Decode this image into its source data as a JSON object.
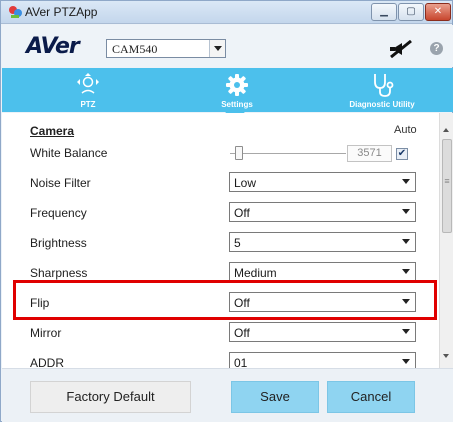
{
  "window": {
    "title": "AVer PTZApp"
  },
  "header": {
    "logo_text": "AVer",
    "camera_model": "CAM540",
    "help_label": "?"
  },
  "tabs": [
    {
      "label": "PTZ",
      "icon": "ptz-joystick-icon"
    },
    {
      "label": "Settings",
      "icon": "gear-icon",
      "active": true
    },
    {
      "label": "Diagnostic Utility",
      "icon": "stethoscope-icon"
    }
  ],
  "camera": {
    "section_title": "Camera",
    "auto_label": "Auto",
    "white_balance": {
      "label": "White Balance",
      "value": "3571",
      "auto_checked": true,
      "slider_fraction": 0.08
    },
    "noise_filter": {
      "label": "Noise Filter",
      "value": "Low"
    },
    "frequency": {
      "label": "Frequency",
      "value": "Off"
    },
    "brightness": {
      "label": "Brightness",
      "value": "5"
    },
    "sharpness": {
      "label": "Sharpness",
      "value": "Medium"
    },
    "flip": {
      "label": "Flip",
      "value": "Off"
    },
    "mirror": {
      "label": "Mirror",
      "value": "Off"
    },
    "addr": {
      "label": "ADDR",
      "value": "01"
    }
  },
  "footer": {
    "factory_default": "Factory Default",
    "save": "Save",
    "cancel": "Cancel"
  },
  "colors": {
    "accent": "#4cc0ec",
    "highlight": "#e00000",
    "button_blue": "#8fd4f1"
  }
}
